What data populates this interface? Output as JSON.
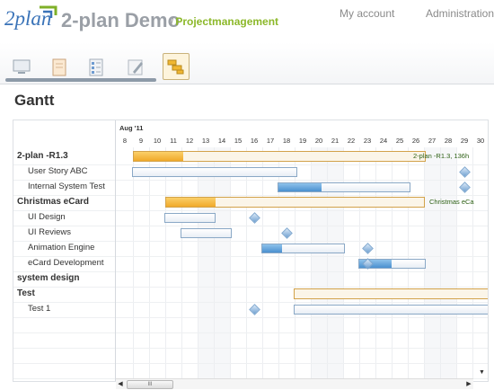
{
  "header": {
    "logo_text": "2plan",
    "title": "2-plan Demo",
    "subtitle_sep": "/",
    "subtitle": "Projectmanagement",
    "nav": {
      "account": "My account",
      "admin": "Administration"
    }
  },
  "toolbar": {
    "buttons": [
      {
        "icon": "monitor-icon"
      },
      {
        "icon": "document-icon"
      },
      {
        "icon": "checklist-icon"
      },
      {
        "icon": "pen-icon"
      },
      {
        "icon": "gantt-icon",
        "active": true
      }
    ]
  },
  "page": {
    "title": "Gantt"
  },
  "gantt": {
    "month": "Aug '11",
    "days": [
      "8",
      "9",
      "10",
      "11",
      "12",
      "13",
      "14",
      "15",
      "16",
      "17",
      "18",
      "19",
      "20",
      "21",
      "22",
      "23",
      "24",
      "25",
      "26",
      "27",
      "28",
      "29",
      "30"
    ],
    "rows": [
      {
        "label": "2-plan -R1.3",
        "type": "group"
      },
      {
        "label": "User Story ABC",
        "type": "child"
      },
      {
        "label": "Internal System Test",
        "type": "child"
      },
      {
        "label": "Christmas eCard",
        "type": "group"
      },
      {
        "label": "UI Design",
        "type": "child"
      },
      {
        "label": "UI Reviews",
        "type": "child"
      },
      {
        "label": "Animation Engine",
        "type": "child"
      },
      {
        "label": "eCard Development",
        "type": "child"
      },
      {
        "label": "system design",
        "type": "group"
      },
      {
        "label": "Test",
        "type": "group"
      },
      {
        "label": "Test 1",
        "type": "child"
      }
    ],
    "bar_labels": {
      "r13": "2-plan -R1.3, 136h",
      "xmas": "Christmas eCa"
    },
    "scroll_thumb": "III",
    "arrows": {
      "left": "◀",
      "right": "▶",
      "down": "▼"
    }
  }
}
